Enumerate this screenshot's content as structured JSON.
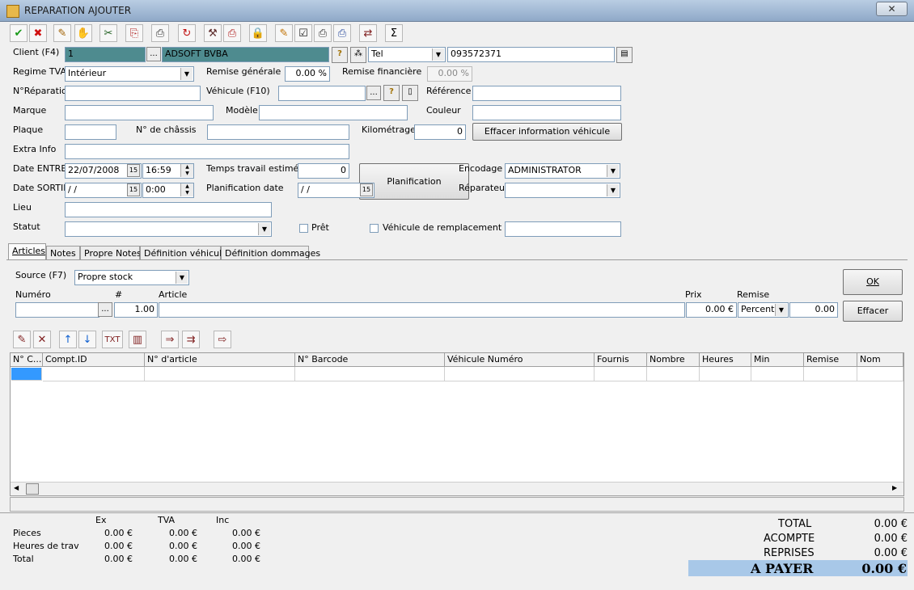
{
  "window": {
    "title": "REPARATION AJOUTER",
    "close": "✕"
  },
  "toolbar": [
    {
      "name": "ok-tool",
      "glyph": "✔",
      "color": "#1a9a1a"
    },
    {
      "name": "cancel-tool",
      "glyph": "✖",
      "color": "#d01010"
    },
    {
      "name": "new-tool",
      "glyph": "✎",
      "color": "#a06000"
    },
    {
      "name": "tool-4",
      "glyph": "✋",
      "color": "#803000"
    },
    {
      "name": "tool-5",
      "glyph": "✂",
      "color": "#206020"
    },
    {
      "name": "tool-6",
      "glyph": "⎘",
      "color": "#b02020"
    },
    {
      "name": "print-tool",
      "glyph": "⎙",
      "color": "#333"
    },
    {
      "name": "refresh-tool",
      "glyph": "↻",
      "color": "#c01010"
    },
    {
      "name": "tool-9",
      "glyph": "⚒",
      "color": "#603030"
    },
    {
      "name": "print2-tool",
      "glyph": "⎙",
      "color": "#b02020"
    },
    {
      "name": "lock-tool",
      "glyph": "🔒",
      "color": "#a08000"
    },
    {
      "name": "tool-12",
      "glyph": "✎",
      "color": "#c07000"
    },
    {
      "name": "check-tool",
      "glyph": "☑",
      "color": "#222"
    },
    {
      "name": "print3-tool",
      "glyph": "⎙",
      "color": "#333"
    },
    {
      "name": "print4-tool",
      "glyph": "⎙",
      "color": "#3050a0"
    },
    {
      "name": "tool-16",
      "glyph": "⇄",
      "color": "#802020"
    },
    {
      "name": "sum-tool",
      "glyph": "Σ",
      "color": "#000"
    }
  ],
  "labels": {
    "client": "Client (F4)",
    "regime": "Regime TVA",
    "remise_gen": "Remise générale",
    "remise_fin": "Remise financière",
    "nrep": "N°Réparation",
    "vehicule": "Véhicule (F10)",
    "reference": "Référence",
    "marque": "Marque",
    "modele": "Modèle",
    "couleur": "Couleur",
    "plaque": "Plaque",
    "chassis": "N° de châssis",
    "km": "Kilométrage",
    "extra": "Extra Info",
    "date_in": "Date ENTREE",
    "date_out": "Date SORTIE",
    "temps": "Temps travail estimée",
    "plan_date": "Planification date",
    "encodage": "Encodage",
    "reparateur": "Réparateur",
    "lieu": "Lieu",
    "statut": "Statut",
    "pret": "Prêt",
    "remplacement": "Véhicule de remplacement en l"
  },
  "fields": {
    "client_id": "1",
    "client_name": "ADSOFT BVBA",
    "phone_type": "Tel",
    "phone": "093572371",
    "regime": "Intérieur",
    "remise_gen": "0.00 %",
    "remise_fin": "0.00 %",
    "km": "0",
    "date_in": "22/07/2008",
    "time_in": "16:59",
    "date_out": " / /",
    "time_out": "0:00",
    "temps": "0",
    "plan_date": " / /",
    "encodage": "ADMINISTRATOR"
  },
  "buttons": {
    "effacer_vehicule": "Effacer information véhicule",
    "planification": "Planification",
    "ok": "OK",
    "effacer": "Effacer",
    "ellipsis": "...",
    "help": "?",
    "cal": "15"
  },
  "tabs": [
    "Articles",
    "Notes",
    "Propre Notes",
    "Définition véhicule",
    "Définition dommages"
  ],
  "articles": {
    "source_label": "Source (F7)",
    "source": "Propre stock",
    "col_numero": "Numéro",
    "col_hash": "#",
    "col_article": "Article",
    "col_prix": "Prix",
    "col_remise": "Remise",
    "qty": "1.00",
    "prix": "0.00 €",
    "remise_type": "Percent",
    "remise": "0.00"
  },
  "grid_tools": [
    {
      "name": "grid-edit-tool",
      "glyph": "✎"
    },
    {
      "name": "grid-delete-tool",
      "glyph": "✕"
    },
    {
      "name": "grid-up-tool",
      "glyph": "↑"
    },
    {
      "name": "grid-down-tool",
      "glyph": "↓"
    },
    {
      "name": "grid-txt-tool",
      "glyph": "TXT"
    },
    {
      "name": "grid-columns-tool",
      "glyph": "▥"
    },
    {
      "name": "grid-export-tool",
      "glyph": "⇒"
    },
    {
      "name": "grid-export2-tool",
      "glyph": "⇉"
    },
    {
      "name": "grid-import-tool",
      "glyph": "⇨"
    }
  ],
  "grid_headers": [
    "N° C...",
    "Compt.ID",
    "N° d'article",
    "N° Barcode",
    "Véhicule Numéro",
    "Fournis",
    "Nombre",
    "Heures",
    "Min",
    "Remise",
    "Nom"
  ],
  "summary": {
    "cols": [
      "Ex",
      "TVA",
      "Inc"
    ],
    "rows": [
      {
        "label": "Pieces",
        "ex": "0.00 €",
        "tva": "0.00 €",
        "inc": "0.00 €"
      },
      {
        "label": "Heures de trav",
        "ex": "0.00 €",
        "tva": "0.00 €",
        "inc": "0.00 €"
      },
      {
        "label": "Total",
        "ex": "0.00 €",
        "tva": "0.00 €",
        "inc": "0.00 €"
      }
    ]
  },
  "totals": {
    "total_label": "TOTAL",
    "total": "0.00 €",
    "acompte_label": "ACOMPTE",
    "acompte": "0.00 €",
    "reprises_label": "REPRISES",
    "reprises": "0.00 €",
    "apayer_label": "A PAYER",
    "apayer": "0.00 €"
  }
}
